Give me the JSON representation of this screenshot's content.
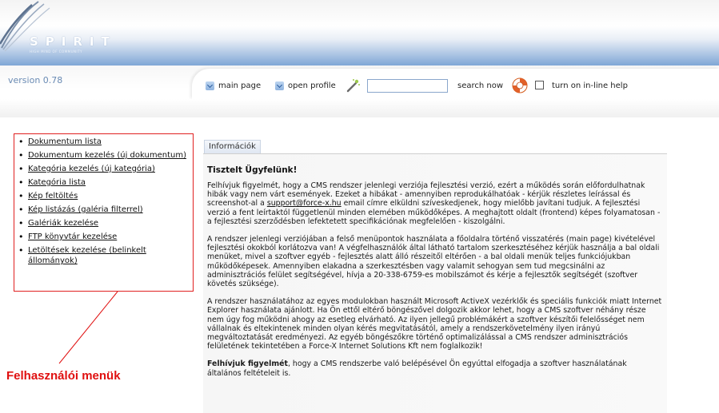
{
  "brand": {
    "logo_text": "SPIRIT",
    "tagline": "HIGH MIND OF COMMUNITY"
  },
  "version": "version 0.78",
  "toolbar": {
    "main_page": "main page",
    "open_profile": "open profile",
    "search_value": "",
    "search_now": "search now",
    "help_label": "turn on in-line help",
    "help_checked": false
  },
  "menu": {
    "items": [
      {
        "label": "Dokumentum lista"
      },
      {
        "label": "Dokumentum kezelés (új dokumentum)"
      },
      {
        "label": "Kategória kezelés (új kategória)"
      },
      {
        "label": "Kategória lista"
      },
      {
        "label": "Kép feltöltés"
      },
      {
        "label": "Kép listázás (galéria filterrel)"
      },
      {
        "label": "Galériák kezelése"
      },
      {
        "label": "FTP könyvtár kezelése"
      },
      {
        "label": "Letöltések kezelése (belinkelt állományok)"
      }
    ]
  },
  "annotation": {
    "label": "Felhasználói menük",
    "color": "#e01010"
  },
  "info": {
    "tab": "Információk",
    "heading": "Tisztelt Ügyfelünk!",
    "p1_before": "Felhívjuk figyelmét, hogy a CMS rendszer jelenlegi verziója fejlesztési verzió, ezért a működés során előfordulhatnak hibák vagy nem várt események. Ezeket a hibákat - amennyiben reprodukálhatóak - kérjük részletes leírással és screenshot-al a ",
    "p1_link": "support@force-x.hu",
    "p1_after": " email címre elküldni szíveskedjenek, hogy mielőbb javítani tudjuk. A fejlesztési verzió a fent leírtaktól függetlenül minden elemében működőképes. A meghajtott oldalt (frontend) képes folyamatosan - a fejlesztési szerződésben lefektetett specifikációnak megfelelően - kiszolgálni.",
    "p2": "A rendszer jelenlegi verziójában a felső menüpontok használata a főoldalra történő visszatérés (main page) kivételével fejlesztési okokból korlátozva van! A végfelhasználók által látható tartalom szerkesztéséhez kérjük használja a bal oldali menüket, mivel a szoftver egyéb - fejlesztés alatt álló részeitől eltérően - a bal oldali menük teljes funkciójukban működőképesek. Amennyiben elakadna a szerkesztésben vagy valamit sehogyan sem tud megcsinálni az adminisztrációs felület segítségével, hívja a 20-338-6759-es mobilszámot és kérje a fejlesztők segítségét (szoftver követés szüksége).",
    "p3": "A rendszer használatához az egyes modulokban használt Microsoft ActiveX vezérklők és speciális funkciók miatt Internet Explorer használata ajánlott. Ha Ön ettől eltérő böngészővel dolgozik akkor lehet, hogy a CMS szoftver néhány része nem úgy fog működni ahogy az esetleg elvárható. Az ilyen jellegű problémákért a szoftver készítői felelősséget nem vállalnak és eltekintenek minden olyan kérés megvitatásától, amely a rendszerkövetelmény ilyen irányú megváltoztatását eredményezi. Az egyéb böngészőkre történő optimalizálással a CMS rendszer adminisztrációs felületének tekintetében a Force-X Internet Solutions Kft nem foglalkozik!",
    "p4_bold": "Felhívjuk figyelmét",
    "p4_rest": ", hogy a CMS rendszerbe való belépésével Ön egyúttal elfogadja a szoftver használatának általános feltételeit is."
  }
}
